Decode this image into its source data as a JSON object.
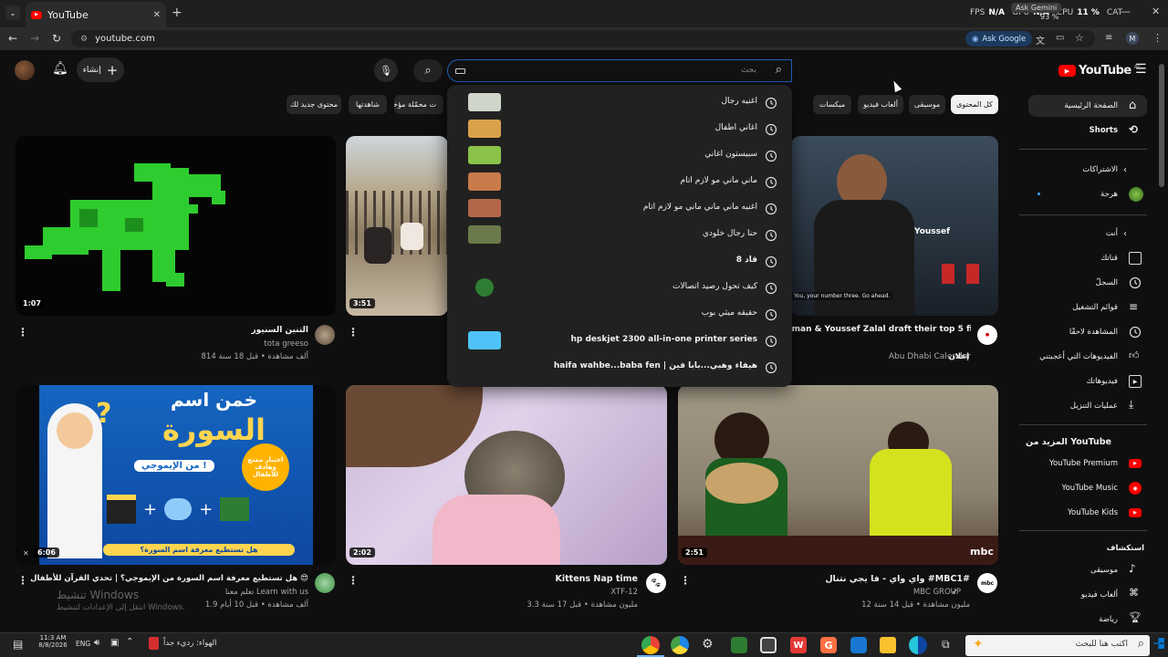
{
  "browser": {
    "tab_title": "YouTube",
    "url": "youtube.com",
    "ask_google": "Ask Google",
    "profile_initial": "M",
    "overlay": {
      "fps_label": "FPS",
      "fps_value": "N/A",
      "gpu_label": "GPU",
      "gpu_value": "N/A",
      "cpu_label": "CPU",
      "cpu_value": "11 %",
      "ask_gemini": "Ask Gemini",
      "ram_value": "93 %",
      "cat_label": "CAT"
    }
  },
  "header": {
    "logo_text": "YouTube",
    "region": "AE",
    "create_label": "إنشاء",
    "search_placeholder": "بحث"
  },
  "chips": [
    "كل المحتوى",
    "موسيقى",
    "ألعاب فيديو",
    "ميكسات",
    "ت محمّلة مؤخرًا",
    "شاهدتها",
    "محتوى جديد لك"
  ],
  "suggestions": [
    {
      "text": "اغنيه رجال",
      "thumb": "#cfd6c9"
    },
    {
      "text": "اغاني اطفال",
      "thumb": "#d9a24a"
    },
    {
      "text": "سبيستون اغاني",
      "thumb": "#8bc34a"
    },
    {
      "text": "ماني ماني مو لازم اتام",
      "thumb": "#c77a4a"
    },
    {
      "text": "اغنيه ماني ماني ماني مو لازم اتام",
      "thumb": "#b2674b"
    },
    {
      "text": "حنا رجال خلودي",
      "thumb": "#6b7a4a"
    },
    {
      "text": "قاد 8",
      "thumb": ""
    },
    {
      "text": "كيف تحول رصيد اتصالات",
      "thumb": "#2e7d32"
    },
    {
      "text": "حقيقه ميثي بوب",
      "thumb": ""
    },
    {
      "text": "hp deskjet 2300 all-in-one printer series",
      "thumb": "#4fc3f7"
    },
    {
      "text": "haifa wahbe...baba fen | هيفاء وهبي...بابا فين",
      "thumb": ""
    }
  ],
  "videos": [
    {
      "title": "التنين السنيور",
      "channel": "tota greeso",
      "meta": "814 ألف مشاهدة • قبل 18 سنة",
      "duration": "1:07"
    },
    {
      "title": "",
      "channel": "",
      "meta": "",
      "duration": "3:51"
    },
    {
      "title": "Usman & Youssef Zalal draft their top 5 fighters #InAbuDhabi!",
      "title_line2": "fighters #InAbuDhabi!",
      "channel": "Abu Dhabi Calendar",
      "meta": "إعلان",
      "duration": "",
      "thumb_caption": "Youssef",
      "subtitle": "You, your number three. Go ahead."
    },
    {
      "title": "هل تستطيع معرفة اسم السورة من الإيموجي؟ | تحدي القرآن للأطفال 😍",
      "channel": "تعلم معنا Learn with us",
      "meta": "1.9 ألف مشاهدة • قبل 10 أيام",
      "duration": "6:06",
      "thumb_title1": "خمن اسم",
      "thumb_title2": "السورة",
      "thumb_sub": "من الإيموجي !",
      "thumb_badge": "اختبار ممتع وهادف للأطفال",
      "thumb_footer": "هل تستطيع معرفة اسم السورة؟"
    },
    {
      "title": "Kittens Nap time",
      "channel": "XTF-12",
      "meta": "3.3 مليون مشاهدة • قبل 17 سنة",
      "duration": "2:02"
    },
    {
      "title": "واي واي - فا يجي نتنال #MBC1#",
      "channel": "MBC GROUP",
      "meta": "12 مليون مشاهدة • قبل 14 سنة",
      "duration": "2:51",
      "thumb_logo": "mbc"
    }
  ],
  "watermark": {
    "line1": "تنشيط Windows",
    "line2": "انتقل إلى الإعدادات لتنشيط Windows."
  },
  "sidebar": {
    "home": "الصفحة الرئيسية",
    "shorts": "Shorts",
    "subs_head": "الاشتراكات",
    "sub_channel": "هرجة",
    "you_head": "أنت",
    "you_items": [
      "قناتك",
      "السجلّ",
      "قوائم التشغيل",
      "المشاهدة لاحقًا",
      "الفيديوهات التي أعجبتني",
      "فيديوهاتك",
      "عمليات التنزيل"
    ],
    "more_head": "المزيد من YouTube",
    "more_items": [
      "YouTube Premium",
      "YouTube Music",
      "YouTube Kids"
    ],
    "explore_head": "استكشاف",
    "explore_items": [
      "موسيقى",
      "ألعاب فيديو",
      "رياضة"
    ]
  },
  "taskbar": {
    "search_placeholder": "اكتب هنا للبحث",
    "weather": "الهواء: رديء جداً",
    "lang": "ENG",
    "time": "11:3 AM",
    "date": "8/8/2026"
  },
  "colors": {
    "accent": "#ff0000",
    "focus": "#1c62b9",
    "background": "#0f0f0f"
  }
}
